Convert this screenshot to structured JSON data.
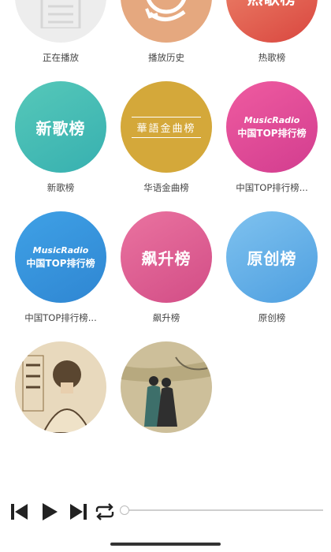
{
  "tiles": [
    {
      "label": "正在播放",
      "icon": "document-music-icon"
    },
    {
      "label": "播放历史",
      "icon": "history-clock-icon"
    },
    {
      "label": "热歌榜",
      "badge_text": "热歌榜"
    },
    {
      "label": "新歌榜",
      "badge_text": "新歌榜"
    },
    {
      "label": "华语金曲榜",
      "badge_text": "華語金曲榜"
    },
    {
      "label": "中国TOP排行榜...",
      "badge_line1": "MusicRadio",
      "badge_line2": "中国TOP排行榜"
    },
    {
      "label": "中国TOP排行榜...",
      "badge_line1": "MusicRadio",
      "badge_line2": "中国TOP排行榜"
    },
    {
      "label": "飙升榜",
      "badge_text": "飙升榜"
    },
    {
      "label": "原创榜",
      "badge_text": "原创榜"
    },
    {
      "label": "",
      "icon": "album-art-portrait"
    },
    {
      "label": "",
      "icon": "album-art-painting"
    }
  ],
  "player": {
    "icons": [
      "skip-previous-icon",
      "play-icon",
      "skip-next-icon",
      "repeat-icon"
    ],
    "progress": 0.0
  }
}
